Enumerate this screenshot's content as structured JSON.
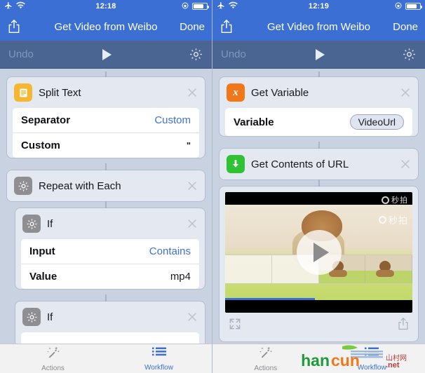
{
  "left": {
    "status": {
      "time": "12:18",
      "airplane_icon": "airplane-icon",
      "wifi_icon": "wifi-icon",
      "lock_icon": "rotation-lock-icon",
      "battery_icon": "battery-icon"
    },
    "navbar": {
      "share_icon": "share-icon",
      "title": "Get Video from Weibo",
      "done_label": "Done"
    },
    "toolbar": {
      "undo_label": "Undo",
      "play_icon": "play-icon",
      "settings_icon": "gear-icon"
    },
    "cards": [
      {
        "icon": "document-icon",
        "icon_color": "#f5b730",
        "title": "Split Text",
        "close_icon": "close-icon",
        "params": [
          {
            "label": "Separator",
            "value": "Custom",
            "kind": "link"
          },
          {
            "label": "Custom",
            "value": "\"",
            "kind": "quote"
          }
        ]
      },
      {
        "icon": "gear-icon",
        "icon_color": "#8e8e93",
        "title": "Repeat with Each",
        "close_icon": "close-icon",
        "params": []
      },
      {
        "icon": "gear-icon",
        "icon_color": "#8e8e93",
        "title": "If",
        "close_icon": "close-icon",
        "params": [
          {
            "label": "Input",
            "value": "Contains",
            "kind": "link"
          },
          {
            "label": "Value",
            "value": "mp4",
            "kind": "plain"
          }
        ]
      },
      {
        "icon": "gear-icon",
        "icon_color": "#8e8e93",
        "title": "If",
        "close_icon": "close-icon",
        "params": []
      }
    ],
    "tabs": [
      {
        "label": "Actions",
        "icon": "magic-wand-icon",
        "active": false
      },
      {
        "label": "Workflow",
        "icon": "list-icon",
        "active": true
      }
    ]
  },
  "right": {
    "status": {
      "time": "12:19",
      "airplane_icon": "airplane-icon",
      "wifi_icon": "wifi-icon",
      "lock_icon": "rotation-lock-icon",
      "battery_icon": "battery-icon"
    },
    "navbar": {
      "share_icon": "share-icon",
      "title": "Get Video from Weibo",
      "done_label": "Done"
    },
    "toolbar": {
      "undo_label": "Undo",
      "play_icon": "play-icon",
      "settings_icon": "gear-icon"
    },
    "cards": [
      {
        "icon": "variable-x-icon",
        "icon_color": "#f07818",
        "title": "Get Variable",
        "close_icon": "close-icon",
        "params": [
          {
            "label": "Variable",
            "value": "VideoUrl",
            "kind": "token"
          }
        ]
      },
      {
        "icon": "download-arrow-icon",
        "icon_color": "#2fc233",
        "title": "Get Contents of URL",
        "close_icon": "close-icon",
        "params": []
      }
    ],
    "preview": {
      "play_icon": "play-icon",
      "expand_icon": "expand-icon",
      "share_icon": "share-icon",
      "overlay_text_1": "秒拍",
      "overlay_text_2": "秒拍"
    },
    "tabs": [
      {
        "label": "Actions",
        "icon": "magic-wand-icon",
        "active": false
      },
      {
        "label": "Workflow",
        "icon": "list-icon",
        "active": true
      }
    ],
    "watermark": {
      "text": "shancun",
      "suffix": ".net"
    }
  },
  "colors": {
    "navbar": "#3b6fd4",
    "toolbar": "#4a6591",
    "background": "#c9d2e0",
    "link": "#4071d6",
    "accent_green": "#2fc233",
    "accent_orange": "#f07818",
    "accent_yellow": "#f5b730",
    "accent_gray": "#8e8e93"
  }
}
